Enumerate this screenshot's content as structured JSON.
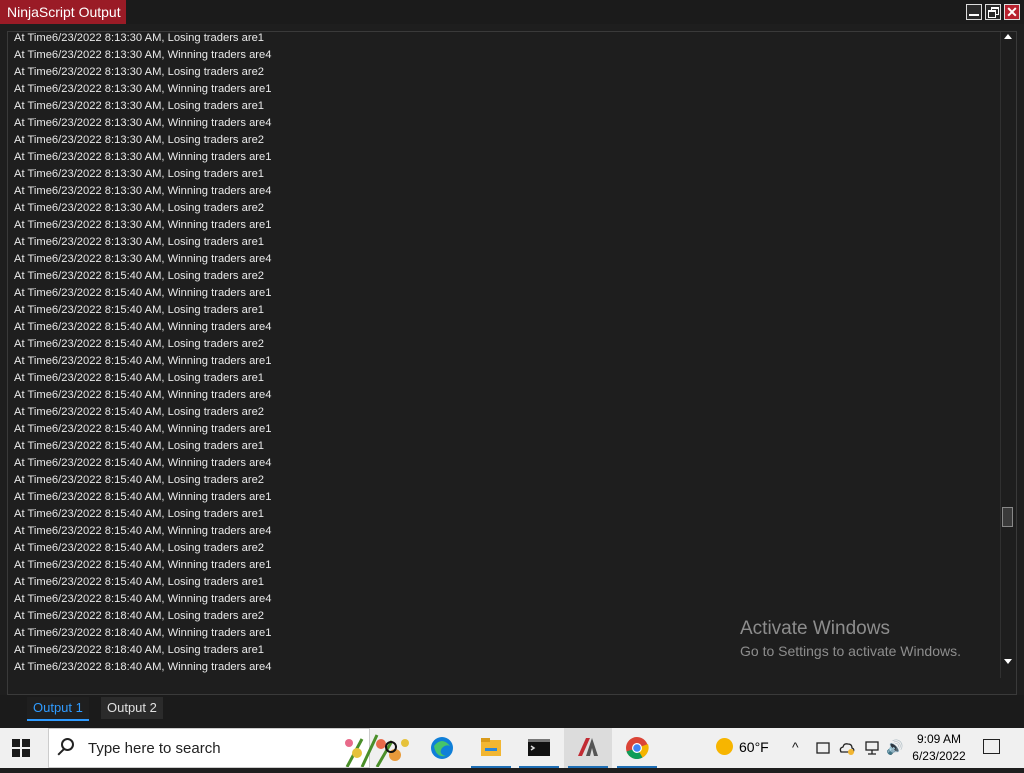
{
  "window": {
    "title": "NinjaScript Output",
    "close_glyph": "✕"
  },
  "log_lines": [
    "At Time6/23/2022 8:13:30 AM, Losing traders are1",
    "At Time6/23/2022 8:13:30 AM, Winning traders are4",
    "At Time6/23/2022 8:13:30 AM, Losing traders are2",
    "At Time6/23/2022 8:13:30 AM, Winning traders are1",
    "At Time6/23/2022 8:13:30 AM, Losing traders are1",
    "At Time6/23/2022 8:13:30 AM, Winning traders are4",
    "At Time6/23/2022 8:13:30 AM, Losing traders are2",
    "At Time6/23/2022 8:13:30 AM, Winning traders are1",
    "At Time6/23/2022 8:13:30 AM, Losing traders are1",
    "At Time6/23/2022 8:13:30 AM, Winning traders are4",
    "At Time6/23/2022 8:13:30 AM, Losing traders are2",
    "At Time6/23/2022 8:13:30 AM, Winning traders are1",
    "At Time6/23/2022 8:13:30 AM, Losing traders are1",
    "At Time6/23/2022 8:13:30 AM, Winning traders are4",
    "At Time6/23/2022 8:15:40 AM, Losing traders are2",
    "At Time6/23/2022 8:15:40 AM, Winning traders are1",
    "At Time6/23/2022 8:15:40 AM, Losing traders are1",
    "At Time6/23/2022 8:15:40 AM, Winning traders are4",
    "At Time6/23/2022 8:15:40 AM, Losing traders are2",
    "At Time6/23/2022 8:15:40 AM, Winning traders are1",
    "At Time6/23/2022 8:15:40 AM, Losing traders are1",
    "At Time6/23/2022 8:15:40 AM, Winning traders are4",
    "At Time6/23/2022 8:15:40 AM, Losing traders are2",
    "At Time6/23/2022 8:15:40 AM, Winning traders are1",
    "At Time6/23/2022 8:15:40 AM, Losing traders are1",
    "At Time6/23/2022 8:15:40 AM, Winning traders are4",
    "At Time6/23/2022 8:15:40 AM, Losing traders are2",
    "At Time6/23/2022 8:15:40 AM, Winning traders are1",
    "At Time6/23/2022 8:15:40 AM, Losing traders are1",
    "At Time6/23/2022 8:15:40 AM, Winning traders are4",
    "At Time6/23/2022 8:15:40 AM, Losing traders are2",
    "At Time6/23/2022 8:15:40 AM, Winning traders are1",
    "At Time6/23/2022 8:15:40 AM, Losing traders are1",
    "At Time6/23/2022 8:15:40 AM, Winning traders are4",
    "At Time6/23/2022 8:18:40 AM, Losing traders are2",
    "At Time6/23/2022 8:18:40 AM, Winning traders are1",
    "At Time6/23/2022 8:18:40 AM, Losing traders are1",
    "At Time6/23/2022 8:18:40 AM, Winning traders are4"
  ],
  "watermark": {
    "title": "Activate Windows",
    "subtitle": "Go to Settings to activate Windows."
  },
  "tabs": [
    {
      "label": "Output 1",
      "active": true
    },
    {
      "label": "Output 2",
      "active": false
    }
  ],
  "taskbar": {
    "search_placeholder": "Type here to search",
    "weather_temp": "60°F",
    "clock_time": "9:09 AM",
    "clock_date": "6/23/2022",
    "tray_up_glyph": "^",
    "volume_glyph": "🔊",
    "icons": [
      "windows-start-icon",
      "search-icon",
      "cortana-icon",
      "edge-icon",
      "file-explorer-icon",
      "terminal-icon",
      "ninjatrader-icon",
      "chrome-icon",
      "weather-sun-icon",
      "notification-icon"
    ],
    "colors": {
      "accent": "#1f6fb5",
      "edge": "#0f7fd8",
      "explorer": "#f2b632",
      "chrome_red": "#db4437"
    }
  }
}
